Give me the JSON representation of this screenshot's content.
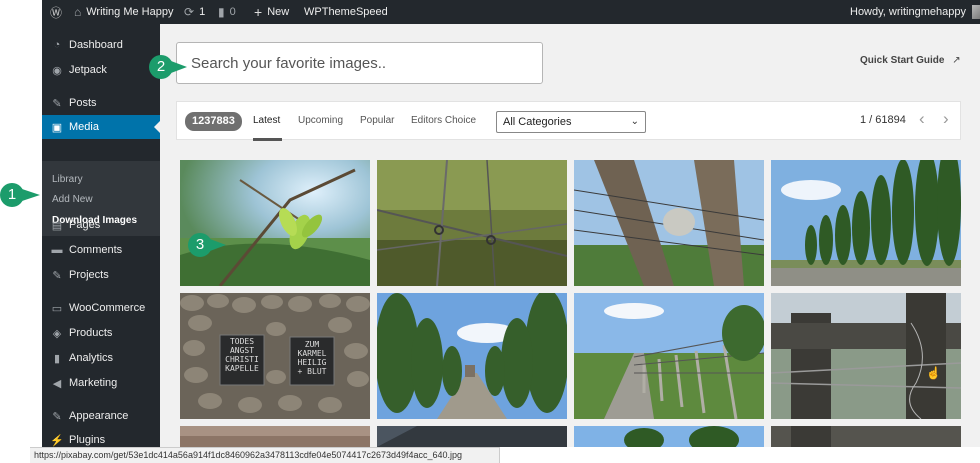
{
  "admin_bar": {
    "site_name": "Writing Me Happy",
    "updates_count": "1",
    "comments_count": "0",
    "new_label": "New",
    "plugin_label": "WPThemeSpeed",
    "greeting": "Howdy, writingmehappy"
  },
  "sidebar": {
    "items": [
      {
        "label": "Dashboard",
        "icon": "dashboard-icon"
      },
      {
        "label": "Jetpack",
        "icon": "jetpack-icon"
      },
      {
        "label": "Posts",
        "icon": "pin-icon"
      },
      {
        "label": "Media",
        "icon": "media-icon"
      },
      {
        "label": "Pages",
        "icon": "pages-icon"
      },
      {
        "label": "Comments",
        "icon": "comments-icon"
      },
      {
        "label": "Projects",
        "icon": "pin-icon"
      },
      {
        "label": "WooCommerce",
        "icon": "woocommerce-icon"
      },
      {
        "label": "Products",
        "icon": "products-icon"
      },
      {
        "label": "Analytics",
        "icon": "analytics-icon"
      },
      {
        "label": "Marketing",
        "icon": "megaphone-icon"
      },
      {
        "label": "Appearance",
        "icon": "brush-icon"
      },
      {
        "label": "Plugins",
        "icon": "plug-icon"
      }
    ],
    "submenu": [
      "Library",
      "Add New",
      "Download Images"
    ]
  },
  "search": {
    "placeholder": "Search your favorite images.."
  },
  "quick_start": "Quick Start Guide",
  "filter": {
    "count": "1237883",
    "tabs": [
      "Latest",
      "Upcoming",
      "Popular",
      "Editors Choice"
    ],
    "active_tab": "Latest",
    "category": "All Categories",
    "pagination": "1 / 61894"
  },
  "images": [
    {
      "subject": "plant-bud"
    },
    {
      "subject": "barbed-wire"
    },
    {
      "subject": "fence-post-lamp"
    },
    {
      "subject": "poplar-row"
    },
    {
      "subject": "stone-wall-plaques"
    },
    {
      "subject": "tree-lined-road"
    },
    {
      "subject": "camp-fence"
    },
    {
      "subject": "wooden-fence-wire"
    },
    {
      "subject": "partial-1"
    },
    {
      "subject": "partial-2"
    },
    {
      "subject": "partial-3"
    },
    {
      "subject": "partial-4"
    }
  ],
  "plaques": {
    "left": [
      "TODES",
      "ANGST",
      "CHRISTI",
      "KAPELLE"
    ],
    "right": [
      "ZUM",
      "KARMEL",
      "HEILIG",
      "+ BLUT"
    ]
  },
  "status_url": "https://pixabay.com/get/53e1dc414a56a914f1dc8460962a3478113cdfe04e5074417c2673d49f4acc_640.jpg",
  "markers": [
    "1",
    "2",
    "3"
  ],
  "colors": {
    "admin_dark": "#23282d",
    "active_blue": "#0073aa",
    "marker_green": "#1c9c6b",
    "content_bg": "#f1f1f1"
  }
}
